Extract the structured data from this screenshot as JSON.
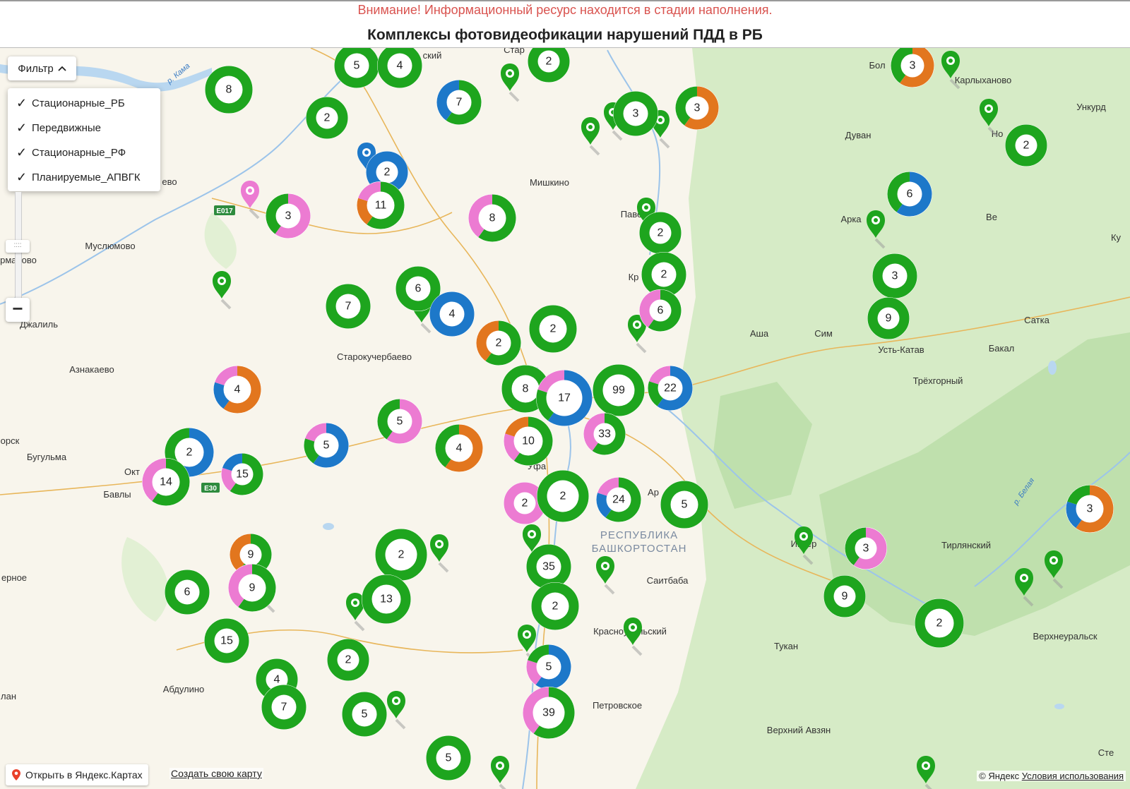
{
  "header": {
    "notice": "Внимание! Информационный ресурс находится в стадии наполнения.",
    "title": "Комплексы фотовидеофикации нарушений ПДД в РБ"
  },
  "filter": {
    "button_label": "Фильтр",
    "items": [
      {
        "label": "Стационарные_РБ",
        "checked": true
      },
      {
        "label": "Передвижные",
        "checked": true
      },
      {
        "label": "Стационарные_РФ",
        "checked": true
      },
      {
        "label": "Планируемые_АПВГК",
        "checked": true
      }
    ]
  },
  "map_labels": {
    "places": [
      "Мишкино",
      "Муслюмово",
      "Старокучербаево",
      "Азнакаево",
      "Бугульма",
      "Бавлы",
      "Абдулино",
      "Джалиль",
      "Дуван",
      "Карлыханово",
      "Аша",
      "Сим",
      "Усть-Катав",
      "Бакал",
      "Сатка",
      "Трёхгорный",
      "Тирлянский",
      "Верхнеуральск",
      "Саитбаба",
      "Красноусольский",
      "Тукан",
      "Петровское",
      "Верхний Авзян",
      "Ункурд",
      "Уфа",
      "Ар",
      "Окт",
      "Бол",
      "Сте",
      "Паве",
      "Кр",
      "Арка",
      "Ве",
      "Но",
      "Ку",
      "Инзер",
      "рманово",
      "орск",
      "ерное",
      "лан",
      "ево",
      "ский",
      "Стар"
    ],
    "region": [
      "РЕСПУБЛИКА",
      "БАШКОРТОСТАН"
    ],
    "rivers": [
      "р. Кама",
      "р. Белая"
    ],
    "roads": [
      "E017",
      "E30"
    ]
  },
  "clusters": [
    {
      "count": "8",
      "colors": [
        "green"
      ]
    },
    {
      "count": "5",
      "colors": [
        "green"
      ]
    },
    {
      "count": "4",
      "colors": [
        "green"
      ]
    },
    {
      "count": "2",
      "colors": [
        "green"
      ]
    },
    {
      "count": "7",
      "colors": [
        "green",
        "blue"
      ]
    },
    {
      "count": "2",
      "colors": [
        "green"
      ]
    },
    {
      "count": "3",
      "colors": [
        "green"
      ]
    },
    {
      "count": "3",
      "colors": [
        "orange",
        "green"
      ]
    },
    {
      "count": "3",
      "colors": [
        "orange",
        "green"
      ]
    },
    {
      "count": "2",
      "colors": [
        "green"
      ]
    },
    {
      "count": "2",
      "colors": [
        "blue"
      ]
    },
    {
      "count": "11",
      "colors": [
        "green",
        "orange",
        "pink"
      ]
    },
    {
      "count": "3",
      "colors": [
        "pink",
        "green"
      ]
    },
    {
      "count": "8",
      "colors": [
        "green",
        "pink"
      ]
    },
    {
      "count": "2",
      "colors": [
        "green"
      ]
    },
    {
      "count": "6",
      "colors": [
        "blue",
        "green"
      ]
    },
    {
      "count": "2",
      "colors": [
        "green"
      ]
    },
    {
      "count": "3",
      "colors": [
        "green"
      ]
    },
    {
      "count": "7",
      "colors": [
        "green"
      ]
    },
    {
      "count": "6",
      "colors": [
        "green"
      ]
    },
    {
      "count": "4",
      "colors": [
        "blue"
      ]
    },
    {
      "count": "6",
      "colors": [
        "green",
        "pink"
      ]
    },
    {
      "count": "2",
      "colors": [
        "green"
      ]
    },
    {
      "count": "9",
      "colors": [
        "green"
      ]
    },
    {
      "count": "2",
      "colors": [
        "green",
        "orange"
      ]
    },
    {
      "count": "4",
      "colors": [
        "orange",
        "blue",
        "pink"
      ]
    },
    {
      "count": "8",
      "colors": [
        "green"
      ]
    },
    {
      "count": "17",
      "colors": [
        "blue",
        "green",
        "pink"
      ]
    },
    {
      "count": "99",
      "colors": [
        "green"
      ]
    },
    {
      "count": "22",
      "colors": [
        "blue",
        "green",
        "pink"
      ]
    },
    {
      "count": "5",
      "colors": [
        "blue",
        "green",
        "pink"
      ]
    },
    {
      "count": "5",
      "colors": [
        "pink",
        "green"
      ]
    },
    {
      "count": "4",
      "colors": [
        "orange",
        "green"
      ]
    },
    {
      "count": "10",
      "colors": [
        "green",
        "pink",
        "orange"
      ]
    },
    {
      "count": "33",
      "colors": [
        "green",
        "pink"
      ]
    },
    {
      "count": "2",
      "colors": [
        "blue",
        "green"
      ]
    },
    {
      "count": "14",
      "colors": [
        "green",
        "pink"
      ]
    },
    {
      "count": "15",
      "colors": [
        "green",
        "pink",
        "blue"
      ]
    },
    {
      "count": "2",
      "colors": [
        "pink"
      ]
    },
    {
      "count": "2",
      "colors": [
        "green"
      ]
    },
    {
      "count": "24",
      "colors": [
        "green",
        "blue",
        "pink"
      ]
    },
    {
      "count": "5",
      "colors": [
        "green"
      ]
    },
    {
      "count": "9",
      "colors": [
        "green",
        "orange"
      ]
    },
    {
      "count": "2",
      "colors": [
        "green"
      ]
    },
    {
      "count": "35",
      "colors": [
        "green"
      ]
    },
    {
      "count": "3",
      "colors": [
        "pink",
        "green"
      ]
    },
    {
      "count": "2",
      "colors": [
        "green"
      ]
    },
    {
      "count": "9",
      "colors": [
        "green"
      ]
    },
    {
      "count": "6",
      "colors": [
        "green"
      ]
    },
    {
      "count": "13",
      "colors": [
        "green"
      ]
    },
    {
      "count": "9",
      "colors": [
        "green",
        "pink"
      ]
    },
    {
      "count": "2",
      "colors": [
        "green"
      ]
    },
    {
      "count": "15",
      "colors": [
        "green"
      ]
    },
    {
      "count": "4",
      "colors": [
        "green"
      ]
    },
    {
      "count": "2",
      "colors": [
        "green"
      ]
    },
    {
      "count": "5",
      "colors": [
        "blue",
        "pink",
        "green"
      ]
    },
    {
      "count": "2",
      "colors": [
        "green"
      ]
    },
    {
      "count": "7",
      "colors": [
        "green"
      ]
    },
    {
      "count": "5",
      "colors": [
        "green"
      ]
    },
    {
      "count": "39",
      "colors": [
        "green",
        "pink"
      ]
    },
    {
      "count": "5",
      "colors": [
        "green"
      ]
    },
    {
      "count": "3",
      "colors": [
        "orange",
        "blue",
        "green"
      ]
    }
  ],
  "footer": {
    "open_yandex": "Открыть в Яндекс.Картах",
    "create_map": "Создать свою карту",
    "copyright": "© Яндекс",
    "terms": "Условия использования"
  },
  "colors": {
    "stationary_rb": "#1ea51e",
    "mobile": "#1d78c9",
    "stationary_rf": "#ec7bd2",
    "planned": "#e2761e",
    "notice": "#d9534f",
    "map_bg": "#f8f5ec",
    "forest": "#d8ecc8"
  },
  "icons": {
    "zoom_out": "minus-icon",
    "filter_chevron": "chevron-up-icon",
    "open_yandex": "location-pin-icon",
    "marker": "map-marker-icon",
    "check": "checkmark-icon"
  }
}
